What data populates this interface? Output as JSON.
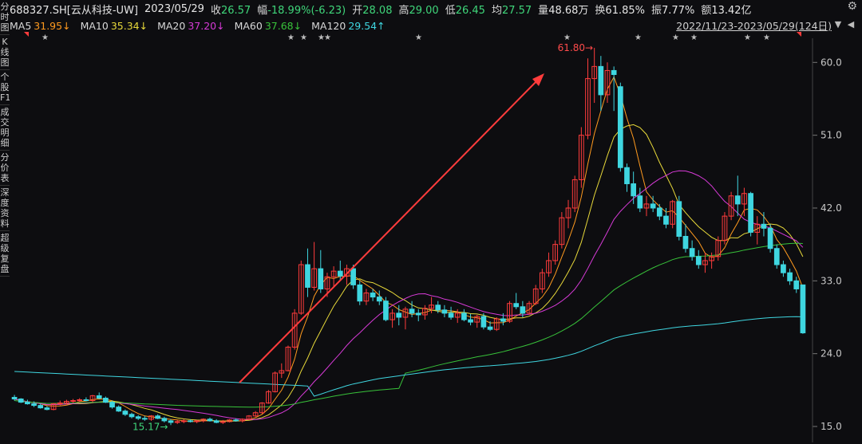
{
  "header": {
    "code": "688327.SH[云从科技-UW]",
    "date": "2023/05/29",
    "close_label": "收",
    "close": "26.57",
    "change_label": "幅",
    "change": "-18.99%(-6.23)",
    "open_label": "开",
    "open": "28.08",
    "high_label": "高",
    "high": "29.00",
    "low_label": "低",
    "low": "26.45",
    "avg_label": "均",
    "avg": "27.57",
    "volume_label": "量",
    "volume": "48.68万",
    "turnover_label": "换",
    "turnover": "61.85%",
    "amplitude_label": "振",
    "amplitude": "7.77%",
    "amount_label": "额",
    "amount": "13.42亿"
  },
  "ma_bar": [
    {
      "name": "MA5",
      "value": "31.95↓",
      "color": "#f0f0f0",
      "value_color": "#ff9a1f"
    },
    {
      "name": "MA10",
      "value": "35.34↓",
      "color": "#f0f0f0",
      "value_color": "#e8d93a"
    },
    {
      "name": "MA20",
      "value": "37.20↓",
      "color": "#f0f0f0",
      "value_color": "#d63ad6"
    },
    {
      "name": "MA60",
      "value": "37.68↓",
      "color": "#f0f0f0",
      "value_color": "#38c23a"
    },
    {
      "name": "MA120",
      "value": "29.54↑",
      "color": "#f0f0f0",
      "value_color": "#3fd6e0"
    }
  ],
  "range": "2022/11/23-2023/05/29(124日)",
  "sidebar_tabs": [
    "分时图",
    "K线图",
    "个股F10",
    "成交明细",
    "分价表",
    "深度资料",
    "超级复盘"
  ],
  "chart_data": {
    "type": "candlestick",
    "yticks": [
      "60.0",
      "51.0",
      "42.0",
      "33.0",
      "24.0",
      "15.0"
    ],
    "ylim": [
      15,
      62
    ],
    "high_annotation": "61.80",
    "low_annotation": "15.17",
    "series": [
      {
        "name": "MA5",
        "color": "#ff9a1f"
      },
      {
        "name": "MA10",
        "color": "#e8d93a"
      },
      {
        "name": "MA20",
        "color": "#d63ad6"
      },
      {
        "name": "MA60",
        "color": "#38c23a"
      },
      {
        "name": "MA120",
        "color": "#3fd6e0"
      }
    ],
    "up_color": "#ff3c3c",
    "down_color": "#3fd6e0",
    "arrow_color": "#ff3c3c",
    "candles": [
      [
        18.6,
        18.9,
        18.2,
        18.4
      ],
      [
        18.4,
        18.5,
        17.9,
        18.0
      ],
      [
        18.0,
        18.3,
        17.7,
        17.8
      ],
      [
        17.8,
        18.1,
        17.4,
        17.6
      ],
      [
        17.6,
        17.8,
        17.2,
        17.3
      ],
      [
        17.3,
        17.5,
        17.0,
        17.1
      ],
      [
        17.1,
        17.9,
        17.0,
        17.8
      ],
      [
        17.8,
        18.2,
        17.6,
        17.9
      ],
      [
        17.9,
        18.3,
        17.7,
        18.1
      ],
      [
        18.1,
        18.4,
        17.9,
        18.2
      ],
      [
        18.2,
        18.5,
        18.0,
        18.3
      ],
      [
        18.3,
        18.6,
        18.1,
        18.2
      ],
      [
        18.2,
        18.9,
        18.0,
        18.8
      ],
      [
        18.8,
        19.2,
        18.4,
        18.5
      ],
      [
        18.5,
        18.7,
        17.9,
        18.0
      ],
      [
        18.0,
        18.2,
        17.2,
        17.4
      ],
      [
        17.4,
        17.6,
        16.8,
        16.9
      ],
      [
        16.9,
        17.1,
        16.3,
        16.5
      ],
      [
        16.5,
        16.7,
        16.0,
        16.2
      ],
      [
        16.2,
        16.4,
        15.8,
        16.0
      ],
      [
        16.0,
        16.3,
        15.7,
        15.9
      ],
      [
        15.9,
        16.4,
        15.7,
        16.3
      ],
      [
        16.3,
        16.5,
        15.9,
        16.0
      ],
      [
        16.0,
        16.2,
        15.5,
        15.7
      ],
      [
        15.7,
        15.9,
        15.17,
        15.5
      ],
      [
        15.5,
        15.8,
        15.3,
        15.6
      ],
      [
        15.6,
        15.9,
        15.4,
        15.7
      ],
      [
        15.7,
        15.9,
        15.5,
        15.6
      ],
      [
        15.6,
        15.8,
        15.4,
        15.7
      ],
      [
        15.7,
        16.0,
        15.5,
        15.9
      ],
      [
        15.9,
        16.1,
        15.6,
        15.7
      ],
      [
        15.7,
        15.9,
        15.4,
        15.5
      ],
      [
        15.5,
        15.8,
        15.3,
        15.6
      ],
      [
        15.6,
        15.9,
        15.5,
        15.8
      ],
      [
        15.8,
        16.0,
        15.6,
        15.7
      ],
      [
        15.7,
        16.0,
        15.5,
        15.9
      ],
      [
        15.9,
        16.4,
        15.8,
        16.3
      ],
      [
        16.3,
        16.9,
        16.2,
        16.7
      ],
      [
        16.7,
        18.0,
        16.6,
        17.9
      ],
      [
        17.9,
        19.5,
        17.8,
        19.3
      ],
      [
        19.3,
        21.8,
        19.2,
        21.6
      ],
      [
        21.6,
        22.8,
        21.0,
        21.9
      ],
      [
        21.9,
        25.0,
        21.8,
        24.8
      ],
      [
        24.8,
        29.5,
        24.5,
        29.0
      ],
      [
        29.0,
        35.5,
        28.8,
        35.0
      ],
      [
        35.0,
        37.0,
        31.0,
        32.2
      ],
      [
        32.2,
        37.8,
        31.8,
        34.5
      ],
      [
        34.5,
        36.8,
        31.5,
        32.0
      ],
      [
        32.0,
        34.0,
        31.0,
        33.5
      ],
      [
        33.5,
        34.8,
        32.2,
        34.2
      ],
      [
        34.2,
        35.5,
        33.0,
        33.6
      ],
      [
        33.6,
        35.0,
        32.5,
        34.5
      ],
      [
        34.5,
        35.0,
        32.0,
        32.5
      ],
      [
        32.5,
        33.0,
        30.0,
        30.5
      ],
      [
        30.5,
        32.0,
        30.0,
        31.5
      ],
      [
        31.5,
        32.0,
        30.5,
        31.0
      ],
      [
        31.0,
        31.8,
        30.0,
        30.5
      ],
      [
        30.5,
        31.0,
        28.0,
        28.2
      ],
      [
        28.2,
        29.5,
        27.2,
        29.0
      ],
      [
        29.0,
        30.0,
        27.5,
        28.5
      ],
      [
        28.5,
        29.8,
        27.0,
        29.5
      ],
      [
        29.5,
        30.5,
        28.5,
        29.0
      ],
      [
        29.0,
        29.5,
        28.0,
        28.8
      ],
      [
        28.8,
        30.0,
        28.2,
        29.6
      ],
      [
        29.6,
        31.0,
        29.0,
        30.0
      ],
      [
        30.0,
        30.5,
        29.0,
        29.4
      ],
      [
        29.4,
        30.0,
        28.5,
        29.0
      ],
      [
        29.0,
        29.8,
        28.2,
        28.5
      ],
      [
        28.5,
        29.5,
        27.8,
        29.0
      ],
      [
        29.0,
        29.5,
        28.0,
        28.2
      ],
      [
        28.2,
        28.9,
        27.5,
        27.9
      ],
      [
        27.9,
        28.8,
        27.2,
        28.6
      ],
      [
        28.6,
        29.0,
        27.0,
        27.3
      ],
      [
        27.3,
        28.0,
        26.8,
        27.0
      ],
      [
        27.0,
        28.5,
        26.8,
        28.3
      ],
      [
        28.3,
        29.0,
        27.5,
        28.0
      ],
      [
        28.0,
        30.5,
        27.8,
        30.2
      ],
      [
        30.2,
        31.5,
        29.5,
        29.8
      ],
      [
        29.8,
        30.5,
        28.5,
        29.0
      ],
      [
        29.0,
        30.5,
        28.8,
        30.2
      ],
      [
        30.2,
        32.5,
        30.0,
        32.0
      ],
      [
        32.0,
        34.5,
        31.5,
        34.0
      ],
      [
        34.0,
        36.5,
        33.5,
        35.5
      ],
      [
        35.5,
        38.0,
        35.0,
        37.5
      ],
      [
        37.5,
        41.5,
        37.0,
        40.8
      ],
      [
        40.8,
        43.0,
        39.5,
        42.0
      ],
      [
        42.0,
        46.0,
        41.5,
        45.5
      ],
      [
        45.5,
        52.0,
        44.5,
        51.0
      ],
      [
        51.0,
        60.5,
        50.5,
        58.0
      ],
      [
        58.0,
        61.8,
        55.0,
        59.5
      ],
      [
        59.5,
        60.8,
        54.0,
        56.0
      ],
      [
        56.0,
        60.0,
        55.0,
        59.0
      ],
      [
        59.0,
        59.5,
        54.0,
        58.5
      ],
      [
        57.0,
        57.5,
        46.5,
        47.0
      ],
      [
        47.0,
        47.5,
        44.0,
        45.0
      ],
      [
        45.0,
        46.5,
        42.5,
        43.5
      ],
      [
        43.5,
        44.5,
        41.5,
        42.0
      ],
      [
        42.0,
        43.5,
        41.0,
        42.5
      ],
      [
        42.5,
        43.5,
        41.5,
        42.0
      ],
      [
        42.0,
        42.5,
        40.5,
        41.0
      ],
      [
        41.0,
        42.0,
        39.5,
        40.0
      ],
      [
        40.0,
        43.0,
        39.5,
        42.8
      ],
      [
        42.8,
        43.5,
        38.0,
        38.5
      ],
      [
        38.5,
        40.0,
        36.5,
        37.0
      ],
      [
        37.0,
        38.0,
        35.5,
        36.0
      ],
      [
        36.0,
        36.8,
        34.5,
        35.0
      ],
      [
        35.0,
        36.5,
        34.0,
        35.5
      ],
      [
        35.5,
        36.5,
        34.5,
        36.0
      ],
      [
        36.0,
        38.5,
        35.5,
        38.0
      ],
      [
        38.0,
        41.5,
        37.5,
        41.0
      ],
      [
        41.0,
        44.0,
        40.5,
        43.5
      ],
      [
        43.5,
        46.0,
        41.0,
        42.5
      ],
      [
        42.5,
        44.5,
        41.0,
        43.8
      ],
      [
        43.8,
        44.0,
        38.5,
        39.0
      ],
      [
        39.0,
        41.0,
        37.5,
        40.0
      ],
      [
        40.0,
        41.5,
        38.5,
        39.5
      ],
      [
        39.5,
        40.0,
        36.5,
        37.0
      ],
      [
        37.0,
        37.5,
        34.5,
        35.0
      ],
      [
        35.0,
        35.5,
        33.5,
        34.0
      ],
      [
        34.0,
        34.5,
        32.5,
        33.0
      ],
      [
        33.0,
        33.5,
        31.5,
        32.0
      ],
      [
        32.5,
        29.0,
        26.45,
        26.57
      ]
    ]
  }
}
